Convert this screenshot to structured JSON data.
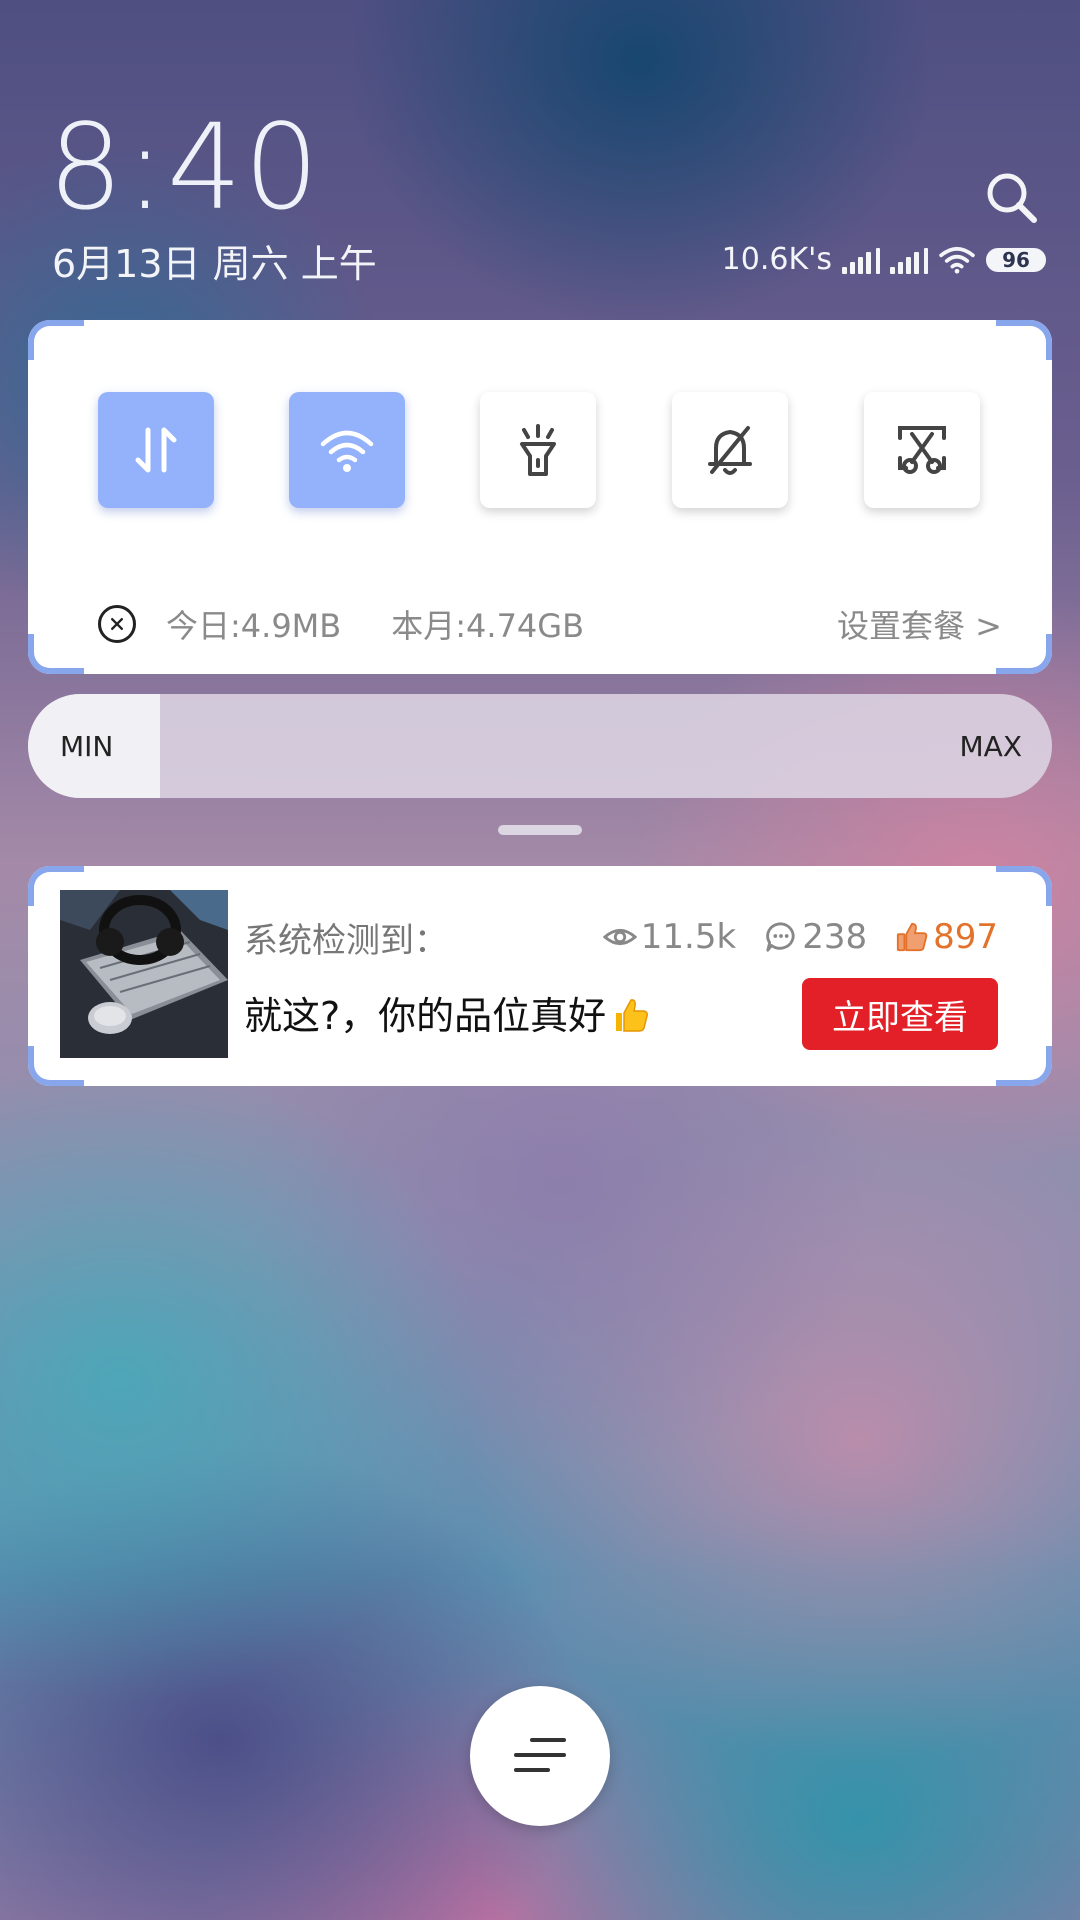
{
  "lockscreen": {
    "time": "8:40",
    "date": "6月13日 周六 上午"
  },
  "status_bar": {
    "net_speed": "10.6K's",
    "battery": "96",
    "icons": [
      "signal-icon",
      "signal-icon",
      "wifi-icon",
      "battery-icon"
    ]
  },
  "quick_settings": {
    "toggles": [
      {
        "name": "mobile-data",
        "icon": "data-arrows-icon",
        "active": true
      },
      {
        "name": "wifi",
        "icon": "wifi-icon",
        "active": true
      },
      {
        "name": "flashlight",
        "icon": "flashlight-icon",
        "active": false
      },
      {
        "name": "mute",
        "icon": "bell-off-icon",
        "active": false
      },
      {
        "name": "screenshot",
        "icon": "screenshot-scissors-icon",
        "active": false
      }
    ],
    "accent_color": "#93b2fb",
    "usage": {
      "today": "今日:4.9MB",
      "month": "本月:4.74GB",
      "plan_link": "设置套餐 >"
    }
  },
  "brightness": {
    "min_label": "MIN",
    "max_label": "MAX",
    "level": 0.1
  },
  "notification": {
    "title": "系统检测到：",
    "views": "11.5k",
    "comments": "238",
    "likes": "897",
    "body": "就这?，你的品位真好",
    "cta": "立即查看",
    "cta_color": "#e32028",
    "likes_color": "#e3732c"
  }
}
